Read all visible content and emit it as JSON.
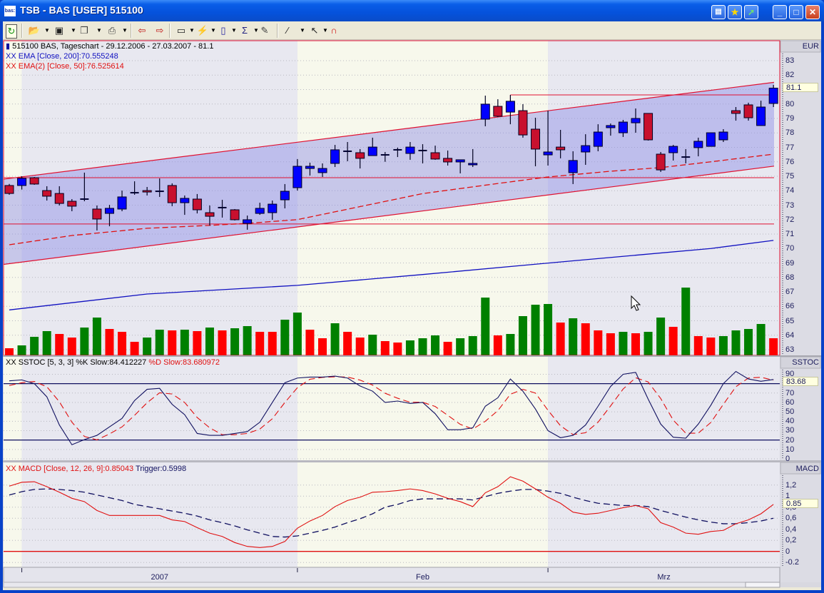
{
  "window": {
    "title": "TSB - BAS [USER] 515100",
    "app_icon_text": "bas:",
    "buttons": [
      "tile-windows-icon",
      "favorites-star-icon",
      "chart-arrow-icon",
      "minimize-icon",
      "maximize-icon",
      "close-icon"
    ]
  },
  "toolbar": {
    "items": [
      "refresh-icon",
      "open-folder-icon",
      "save-icon",
      "copy-icon",
      "print-icon",
      "import-chart-icon",
      "export-chart-icon",
      "window-layout-icon",
      "indicator-wizard-icon",
      "chart-type-icon",
      "sigma-indicator-icon",
      "properties-icon",
      "draw-line-icon",
      "pointer-icon",
      "magnet-icon"
    ]
  },
  "chart": {
    "header": "515100  BAS, Tageschart - 29.12.2006 - 27.03.2007 - 81.1",
    "ema200_label": "XX EMA [Close, 200]:70.555248",
    "ema50_label": "XX EMA(2) [Close, 50]:76.525614",
    "sstoc_label_k": "XX SSTOC [5, 3, 3] %K Slow:84.412227",
    "sstoc_label_d": "%D Slow:83.680972",
    "macd_label": "XX MACD [Close, 12, 26, 9]:0.85043",
    "trigger_label": "Trigger:0.5998",
    "price_axis_title": "EUR",
    "sstoc_axis_title": "SSTOC",
    "macd_axis_title": "MACD",
    "last_price": "81.1",
    "last_sstoc": "83.68",
    "last_macd": "0.85",
    "colors": {
      "up": "#0000FF",
      "down": "#C8102E",
      "vol_up": "#008000",
      "vol_down": "#FF0000",
      "ema200": "#1010C0",
      "ema50": "#E01010",
      "band_a": "#F7F8EC",
      "band_b": "#E8E8F0",
      "channel": "#B8B8EE"
    }
  },
  "chart_data": [
    {
      "type": "candlestick",
      "title": "515100  BAS, Tageschart - 29.12.2006 - 27.03.2007 - 81.1",
      "ylabel": "EUR",
      "ylim": [
        63,
        83
      ],
      "yticks": [
        "63",
        "64",
        "65",
        "66",
        "67",
        "68",
        "69",
        "70",
        "71",
        "72",
        "73",
        "74",
        "75",
        "76",
        "77",
        "78",
        "79",
        "80",
        "81",
        "82",
        "83"
      ],
      "months": [
        {
          "label": "",
          "start_index": 0
        },
        {
          "label": "2007",
          "start_index": 1
        },
        {
          "label": "Feb",
          "start_index": 23
        },
        {
          "label": "Mrz",
          "start_index": 43
        }
      ],
      "ohlc": [
        [
          74.36,
          74.47,
          73.72,
          73.81
        ],
        [
          74.36,
          75.0,
          74.08,
          74.86
        ],
        [
          74.9,
          74.95,
          74.41,
          74.46
        ],
        [
          74.01,
          74.31,
          73.32,
          73.62
        ],
        [
          73.81,
          74.31,
          72.98,
          73.12
        ],
        [
          73.27,
          73.42,
          72.58,
          72.93
        ],
        [
          73.42,
          75.25,
          73.27,
          73.42
        ],
        [
          72.73,
          72.98,
          71.25,
          72.04
        ],
        [
          72.43,
          73.02,
          71.54,
          72.78
        ],
        [
          72.73,
          74.01,
          72.58,
          73.57
        ],
        [
          73.86,
          74.65,
          73.72,
          73.86
        ],
        [
          74.01,
          74.26,
          73.67,
          73.91
        ],
        [
          73.96,
          74.85,
          73.57,
          73.96
        ],
        [
          74.36,
          74.51,
          72.93,
          73.17
        ],
        [
          73.17,
          73.67,
          72.33,
          73.47
        ],
        [
          73.42,
          73.77,
          72.43,
          72.68
        ],
        [
          72.48,
          72.98,
          71.59,
          72.23
        ],
        [
          72.83,
          73.37,
          72.14,
          72.83
        ],
        [
          72.68,
          72.73,
          71.94,
          71.99
        ],
        [
          71.74,
          72.28,
          71.3,
          71.99
        ],
        [
          72.43,
          73.17,
          72.33,
          72.78
        ],
        [
          72.48,
          73.32,
          71.99,
          73.07
        ],
        [
          73.37,
          74.46,
          72.78,
          73.96
        ],
        [
          74.21,
          76.19,
          74.01,
          75.69
        ],
        [
          75.54,
          75.94,
          75.05,
          75.69
        ],
        [
          75.25,
          75.89,
          74.95,
          75.54
        ],
        [
          75.89,
          77.17,
          75.64,
          76.83
        ],
        [
          76.73,
          77.37,
          76.04,
          76.73
        ],
        [
          76.63,
          76.88,
          75.54,
          76.24
        ],
        [
          76.43,
          77.67,
          76.43,
          77.02
        ],
        [
          76.48,
          76.68,
          76.0,
          76.48
        ],
        [
          76.83,
          76.98,
          76.33,
          76.83
        ],
        [
          76.58,
          77.37,
          76.14,
          77.02
        ],
        [
          76.78,
          77.22,
          75.89,
          76.78
        ],
        [
          76.63,
          77.12,
          76.14,
          76.19
        ],
        [
          76.24,
          76.78,
          75.74,
          75.99
        ],
        [
          75.99,
          76.14,
          75.2,
          76.14
        ],
        [
          75.79,
          76.88,
          75.64,
          75.89
        ],
        [
          78.95,
          80.58,
          78.46,
          79.99
        ],
        [
          79.84,
          80.33,
          79.1,
          79.15
        ],
        [
          79.44,
          80.63,
          78.6,
          80.19
        ],
        [
          79.54,
          79.99,
          77.67,
          77.86
        ],
        [
          78.26,
          79.05,
          75.69,
          76.88
        ],
        [
          76.48,
          79.54,
          75.74,
          76.68
        ],
        [
          77.02,
          78.21,
          76.24,
          76.83
        ],
        [
          75.25,
          76.73,
          74.46,
          76.09
        ],
        [
          76.68,
          77.91,
          75.79,
          77.12
        ],
        [
          77.07,
          78.6,
          76.73,
          78.06
        ],
        [
          78.36,
          78.65,
          77.81,
          78.51
        ],
        [
          78.01,
          78.9,
          77.72,
          78.75
        ],
        [
          78.7,
          79.69,
          78.01,
          79.0
        ],
        [
          79.35,
          79.35,
          77.47,
          77.52
        ],
        [
          76.53,
          76.68,
          75.3,
          75.44
        ],
        [
          76.63,
          77.17,
          76.09,
          77.07
        ],
        [
          76.33,
          76.88,
          75.89,
          76.33
        ],
        [
          76.98,
          77.67,
          76.38,
          77.42
        ],
        [
          77.07,
          78.01,
          77.07,
          78.01
        ],
        [
          77.52,
          78.26,
          77.37,
          78.06
        ],
        [
          79.54,
          79.79,
          78.85,
          79.35
        ],
        [
          79.94,
          80.09,
          78.85,
          79.05
        ],
        [
          78.51,
          80.23,
          78.51,
          79.79
        ],
        [
          80.04,
          81.32,
          79.79,
          81.1
        ]
      ],
      "volume_relative": [
        10,
        14,
        26,
        34,
        30,
        25,
        39,
        53,
        37,
        33,
        19,
        25,
        36,
        35,
        36,
        34,
        39,
        35,
        38,
        41,
        33,
        33,
        50,
        60,
        36,
        24,
        45,
        33,
        25,
        29,
        20,
        18,
        21,
        24,
        28,
        19,
        24,
        27,
        81,
        28,
        30,
        55,
        71,
        72,
        46,
        52,
        45,
        35,
        31,
        33,
        31,
        33,
        53,
        40,
        95,
        27,
        25,
        27,
        35,
        37,
        44,
        24
      ],
      "volume_dir": [
        "d",
        "u",
        "u",
        "u",
        "d",
        "d",
        "u",
        "u",
        "d",
        "d",
        "d",
        "u",
        "u",
        "d",
        "u",
        "d",
        "u",
        "d",
        "u",
        "u",
        "d",
        "d",
        "u",
        "u",
        "d",
        "d",
        "u",
        "d",
        "d",
        "u",
        "d",
        "d",
        "u",
        "u",
        "u",
        "d",
        "u",
        "u",
        "u",
        "d",
        "u",
        "u",
        "u",
        "u",
        "d",
        "u",
        "d",
        "d",
        "d",
        "u",
        "d",
        "u",
        "u",
        "d",
        "u",
        "d",
        "d",
        "u",
        "u",
        "u",
        "u",
        "d"
      ],
      "ema200": {
        "index": [
          0,
          11,
          23,
          33,
          45,
          56,
          61
        ],
        "value": [
          65.75,
          66.85,
          67.45,
          68.2,
          69.15,
          70.0,
          70.56
        ]
      },
      "ema50": {
        "index": [
          0,
          5,
          11,
          16,
          19,
          23,
          28,
          33,
          39,
          43,
          48,
          52,
          56,
          61
        ],
        "value": [
          70.26,
          70.9,
          71.4,
          71.6,
          71.74,
          72.0,
          72.9,
          73.8,
          74.5,
          74.95,
          75.35,
          75.6,
          76.0,
          76.53
        ]
      },
      "channel": {
        "upper": [
          74.8,
          81.5
        ],
        "lower": [
          68.9,
          75.7
        ]
      },
      "horizontal_lines": [
        {
          "value": 74.9,
          "from_index": 0
        },
        {
          "value": 71.7,
          "from_index": 0
        },
        {
          "value": 80.63,
          "from_index": 40
        }
      ]
    },
    {
      "type": "line",
      "title": "SSTOC [5, 3, 3]",
      "ylim": [
        0,
        90
      ],
      "yticks": [
        "0",
        "10",
        "20",
        "30",
        "40",
        "50",
        "60",
        "70",
        "80",
        "90"
      ],
      "levels": [
        20,
        80
      ],
      "series": [
        {
          "name": "%K Slow",
          "values": [
            83,
            84,
            80,
            66,
            36,
            15,
            20.5,
            25,
            34,
            43,
            62,
            74,
            75,
            58,
            47,
            27,
            25,
            25,
            27,
            29,
            39,
            60,
            81,
            86,
            87,
            87,
            88,
            86,
            77.5,
            72,
            60,
            61.5,
            59,
            60,
            48,
            31,
            31,
            33,
            56,
            65,
            85,
            72,
            53,
            30,
            22.5,
            25,
            36,
            56,
            77,
            90,
            92,
            63.5,
            37,
            23,
            22,
            37,
            57,
            80,
            93,
            85,
            82.5,
            84.4
          ]
        },
        {
          "name": "%D Slow",
          "values": [
            78,
            81,
            82.3,
            76.7,
            60.7,
            39,
            23.8,
            20.2,
            26.5,
            34,
            46.3,
            59.7,
            70.3,
            69,
            60,
            44,
            33,
            25.7,
            25.7,
            27,
            31.7,
            42.7,
            60,
            75.7,
            84.7,
            86.7,
            87.3,
            87,
            83.8,
            78.5,
            69.8,
            64.5,
            60.2,
            60.2,
            55.7,
            46.3,
            36.7,
            31.7,
            40,
            51.3,
            68.7,
            74,
            70,
            51.7,
            35.2,
            25.8,
            27.8,
            39,
            56.3,
            74.3,
            86.3,
            81.8,
            64.2,
            41.2,
            27.3,
            27.3,
            38.7,
            58,
            76.7,
            86,
            86.8,
            83.7
          ]
        }
      ]
    },
    {
      "type": "line",
      "title": "MACD [Close, 12, 26, 9]",
      "ylim": [
        -0.2,
        1.2
      ],
      "yticks": [
        "-0.2",
        "0",
        "0,2",
        "0,4",
        "0,6",
        "0,8",
        "1",
        "1,2"
      ],
      "ytick_values": [
        -0.2,
        0,
        0.2,
        0.4,
        0.6,
        0.8,
        1.0,
        1.2
      ],
      "series": [
        {
          "name": "MACD",
          "values": [
            1.18,
            1.25,
            1.26,
            1.17,
            1.07,
            0.96,
            0.9,
            0.74,
            0.65,
            0.65,
            0.65,
            0.65,
            0.65,
            0.57,
            0.54,
            0.43,
            0.33,
            0.27,
            0.16,
            0.09,
            0.07,
            0.09,
            0.18,
            0.42,
            0.55,
            0.65,
            0.81,
            0.92,
            0.98,
            1.07,
            1.08,
            1.1,
            1.13,
            1.1,
            1.04,
            0.96,
            0.9,
            0.81,
            1.06,
            1.17,
            1.35,
            1.27,
            1.13,
            0.98,
            0.87,
            0.71,
            0.67,
            0.69,
            0.74,
            0.79,
            0.83,
            0.77,
            0.52,
            0.44,
            0.33,
            0.31,
            0.36,
            0.38,
            0.5,
            0.57,
            0.68,
            0.85
          ]
        },
        {
          "name": "Trigger",
          "values": [
            1.02,
            1.08,
            1.12,
            1.13,
            1.12,
            1.1,
            1.07,
            1.02,
            0.97,
            0.92,
            0.85,
            0.81,
            0.77,
            0.73,
            0.69,
            0.64,
            0.57,
            0.52,
            0.46,
            0.39,
            0.33,
            0.27,
            0.26,
            0.28,
            0.33,
            0.38,
            0.44,
            0.52,
            0.59,
            0.68,
            0.8,
            0.85,
            0.92,
            0.95,
            0.95,
            0.95,
            0.95,
            0.93,
            0.99,
            1.05,
            1.09,
            1.12,
            1.12,
            1.09,
            1.05,
            0.98,
            0.92,
            0.87,
            0.85,
            0.83,
            0.83,
            0.81,
            0.74,
            0.68,
            0.62,
            0.57,
            0.53,
            0.5,
            0.5,
            0.52,
            0.55,
            0.6
          ]
        }
      ]
    }
  ]
}
